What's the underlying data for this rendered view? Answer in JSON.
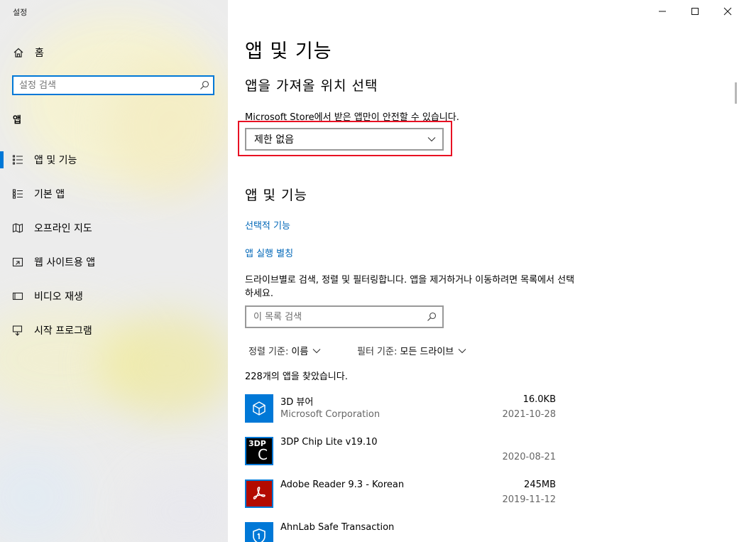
{
  "window": {
    "title": "설정"
  },
  "sidebar": {
    "home_label": "홈",
    "search": {
      "placeholder": "설정 검색"
    },
    "section_label": "앱",
    "items": [
      {
        "label": "앱 및 기능",
        "icon": "apps-features-icon",
        "active": true
      },
      {
        "label": "기본 앱",
        "icon": "default-apps-icon",
        "active": false
      },
      {
        "label": "오프라인 지도",
        "icon": "offline-maps-icon",
        "active": false
      },
      {
        "label": "웹 사이트용 앱",
        "icon": "apps-for-websites-icon",
        "active": false
      },
      {
        "label": "비디오 재생",
        "icon": "video-playback-icon",
        "active": false
      },
      {
        "label": "시작 프로그램",
        "icon": "startup-icon",
        "active": false
      }
    ]
  },
  "main": {
    "title": "앱 및 기능",
    "source": {
      "title": "앱을 가져올 위치 선택",
      "description": "Microsoft Store에서 받은 앱만이 안전할 수 있습니다.",
      "selected": "제한 없음"
    },
    "apps_section": {
      "title": "앱 및 기능",
      "link_optional": "선택적 기능",
      "link_alias": "앱 실행 별칭",
      "filter_desc": "드라이브별로 검색, 정렬 및 필터링합니다. 앱을 제거하거나 이동하려면 목록에서 선택하세요.",
      "search_placeholder": "이 목록 검색",
      "sort_label": "정렬 기준:",
      "sort_value": "이름",
      "filter_label": "필터 기준:",
      "filter_value": "모든 드라이브",
      "count_text": "228개의 앱을 찾았습니다."
    },
    "apps": [
      {
        "name": "3D 뷰어",
        "publisher": "Microsoft Corporation",
        "size": "16.0KB",
        "date": "2021-10-28",
        "icon": "3d-viewer-icon",
        "color": "#0078d7"
      },
      {
        "name": "3DP Chip Lite v19.10",
        "publisher": "",
        "size": "",
        "date": "2020-08-21",
        "icon": "3dp-chip-icon",
        "color": "#000000",
        "icon_top": "3DP",
        "icon_letter": "C"
      },
      {
        "name": "Adobe Reader 9.3 - Korean",
        "publisher": "",
        "size": "245MB",
        "date": "2019-11-12",
        "icon": "adobe-reader-icon",
        "color": "#b30b00"
      },
      {
        "name": "AhnLab Safe Transaction",
        "publisher": "",
        "size": "",
        "date": "",
        "icon": "ahnlab-shield-icon",
        "color": "#0078d7"
      }
    ]
  },
  "colors": {
    "accent": "#0078d7",
    "link": "#0067b8",
    "highlight": "#e81123"
  }
}
